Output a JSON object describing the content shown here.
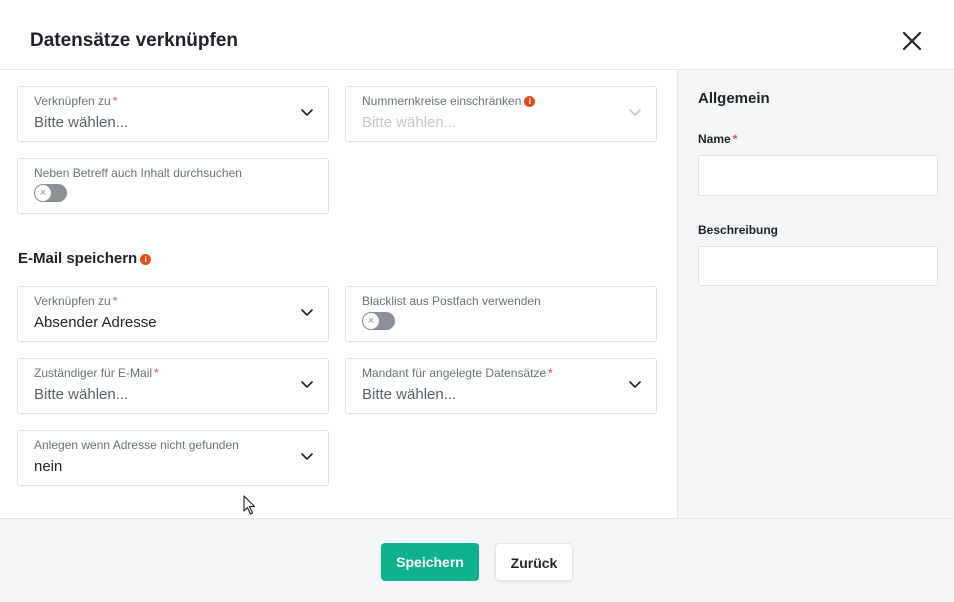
{
  "dialog": {
    "title": "Datensätze verknüpfen"
  },
  "fields": {
    "link_to": {
      "label": "Verknüpfen zu",
      "required": "*",
      "value": "Bitte wählen..."
    },
    "number_ranges": {
      "label": "Nummernkreise einschränken",
      "value": "Bitte wählen..."
    },
    "search_content": {
      "label": "Neben Betreff auch Inhalt durchsuchen"
    }
  },
  "email_section": {
    "title": "E-Mail speichern",
    "link_to": {
      "label": "Verknüpfen zu",
      "required": "*",
      "value": "Absender Adresse"
    },
    "blacklist": {
      "label": "Blacklist aus Postfach verwenden"
    },
    "responsible": {
      "label": "Zuständiger für E-Mail",
      "required": "*",
      "value": "Bitte wählen..."
    },
    "client": {
      "label": "Mandant für angelegte Datensätze",
      "required": "*",
      "value": "Bitte wählen..."
    },
    "create_if_not_found": {
      "label": "Anlegen wenn Adresse nicht gefunden",
      "value": "nein"
    }
  },
  "sidebar": {
    "title": "Allgemein",
    "name_label": "Name",
    "name_required": "*",
    "description_label": "Beschreibung"
  },
  "footer": {
    "save_label": "Speichern",
    "back_label": "Zurück"
  },
  "icons": {
    "info": "i",
    "toggle_off": "×"
  },
  "colors": {
    "primary": "#0fb08c",
    "required": "#e5484d",
    "info": "#e24a1f"
  }
}
